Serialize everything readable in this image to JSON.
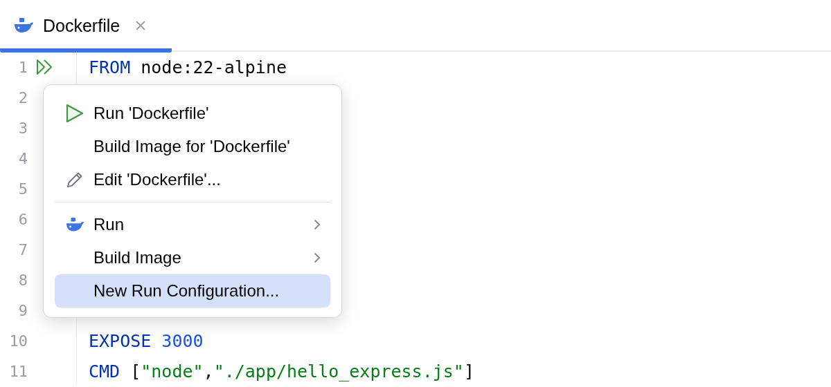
{
  "tab": {
    "title": "Dockerfile",
    "selected": true
  },
  "lines": [
    {
      "number": "1",
      "run_marker": true,
      "tokens": [
        {
          "kind": "keyword",
          "text": "FROM"
        },
        {
          "kind": "plain",
          "text": " node:22-alpine"
        }
      ]
    },
    {
      "number": "2",
      "run_marker": false
    },
    {
      "number": "3",
      "run_marker": false
    },
    {
      "number": "4",
      "run_marker": false
    },
    {
      "number": "5",
      "run_marker": false
    },
    {
      "number": "6",
      "run_marker": false
    },
    {
      "number": "7",
      "run_marker": false
    },
    {
      "number": "8",
      "run_marker": false
    },
    {
      "number": "9",
      "run_marker": false
    },
    {
      "number": "10",
      "run_marker": false,
      "tokens": [
        {
          "kind": "keyword",
          "text": "EXPOSE"
        },
        {
          "kind": "number",
          "text": "3000",
          "spaced": true
        }
      ]
    },
    {
      "number": "11",
      "run_marker": false,
      "tokens": [
        {
          "kind": "keyword",
          "text": "CMD"
        },
        {
          "kind": "plain",
          "text": " ["
        },
        {
          "kind": "string",
          "text": "\"node\""
        },
        {
          "kind": "plain",
          "text": ","
        },
        {
          "kind": "string",
          "text": "\"./app/hello_express.js\""
        },
        {
          "kind": "plain",
          "text": "]"
        }
      ]
    }
  ],
  "menu": [
    {
      "kind": "play",
      "label": "Run 'Dockerfile'",
      "submenu": false,
      "selected": false
    },
    {
      "kind": "plain",
      "label": "Build Image for 'Dockerfile'",
      "submenu": false,
      "selected": false
    },
    {
      "kind": "edit",
      "label": "Edit 'Dockerfile'...",
      "submenu": false,
      "selected": false
    },
    {
      "kind": "separator"
    },
    {
      "kind": "docker",
      "label": "Run",
      "submenu": true,
      "selected": false
    },
    {
      "kind": "plain",
      "label": "Build Image",
      "submenu": true,
      "selected": false
    },
    {
      "kind": "plain",
      "label": "New Run Configuration...",
      "submenu": false,
      "selected": true
    }
  ]
}
